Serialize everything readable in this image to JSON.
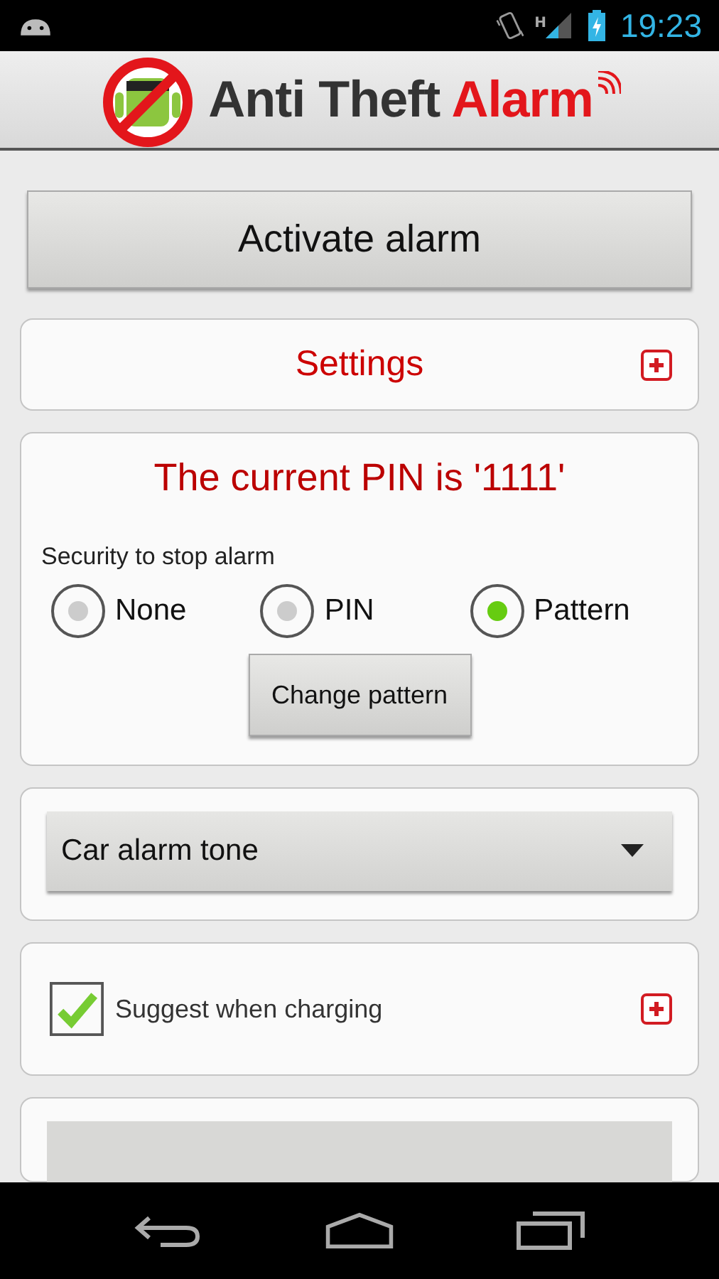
{
  "status_bar": {
    "network_type": "H",
    "time": "19:23"
  },
  "header": {
    "title": "Anti Theft",
    "title_accent": "Alarm"
  },
  "activate_button": "Activate alarm",
  "settings": {
    "label": "Settings",
    "expanded": false
  },
  "pin_card": {
    "message": "The current PIN is '1111'",
    "security_label": "Security to stop alarm",
    "options": [
      {
        "label": "None",
        "selected": false
      },
      {
        "label": "PIN",
        "selected": false
      },
      {
        "label": "Pattern",
        "selected": true
      }
    ],
    "button": "Change pattern"
  },
  "tone_dropdown": {
    "value": "Car alarm tone"
  },
  "charging": {
    "label": "Suggest when charging",
    "checked": true,
    "expanded": false
  }
}
